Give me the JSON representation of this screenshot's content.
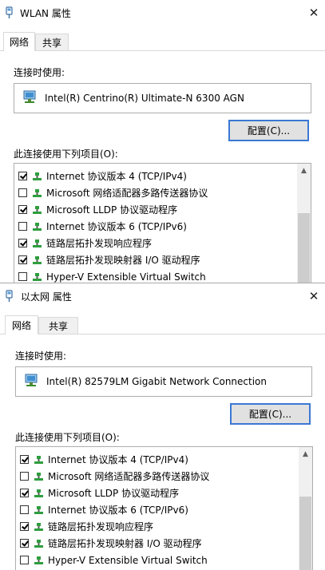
{
  "dialogs": [
    {
      "title": "WLAN 属性",
      "close_glyph": "✕",
      "tabs": [
        "网络",
        "共享"
      ],
      "connect_using_label": "连接时使用:",
      "adapter_name": "Intel(R) Centrino(R) Ultimate-N 6300 AGN",
      "config_button": "配置(C)...",
      "items_label": "此连接使用下列项目(O):",
      "items": [
        {
          "label": "Internet 协议版本 4 (TCP/IPv4)",
          "checked": true
        },
        {
          "label": "Microsoft 网络适配器多路传送器协议",
          "checked": false
        },
        {
          "label": "Microsoft LLDP 协议驱动程序",
          "checked": true
        },
        {
          "label": "Internet 协议版本 6 (TCP/IPv6)",
          "checked": false
        },
        {
          "label": "链路层拓扑发现响应程序",
          "checked": true
        },
        {
          "label": "链路层拓扑发现映射器 I/O 驱动程序",
          "checked": true
        },
        {
          "label": "Hyper-V Extensible Virtual Switch",
          "checked": false
        }
      ]
    },
    {
      "title": "以太网 属性",
      "close_glyph": "✕",
      "tabs": [
        "网络",
        "共享"
      ],
      "connect_using_label": "连接时使用:",
      "adapter_name": "Intel(R) 82579LM Gigabit Network Connection",
      "config_button": "配置(C)...",
      "items_label": "此连接使用下列项目(O):",
      "items": [
        {
          "label": "Internet 协议版本 4 (TCP/IPv4)",
          "checked": true
        },
        {
          "label": "Microsoft 网络适配器多路传送器协议",
          "checked": false
        },
        {
          "label": "Microsoft LLDP 协议驱动程序",
          "checked": true
        },
        {
          "label": "Internet 协议版本 6 (TCP/IPv6)",
          "checked": false
        },
        {
          "label": "链路层拓扑发现响应程序",
          "checked": true
        },
        {
          "label": "链路层拓扑发现映射器 I/O 驱动程序",
          "checked": true
        },
        {
          "label": "Hyper-V Extensible Virtual Switch",
          "checked": false
        }
      ]
    }
  ],
  "icons": {
    "title_icon": "network-plug-icon",
    "adapter_icon": "network-adapter-icon",
    "item_icon": "network-component-icon",
    "scroll_up": "▲",
    "scroll_down": "▼"
  },
  "colors": {
    "accent_border": "#3b78d4",
    "button_face": "#e1e1e1",
    "item_icon_green": "#2e9e3e",
    "scrollbar_track": "#f0f0f0"
  }
}
